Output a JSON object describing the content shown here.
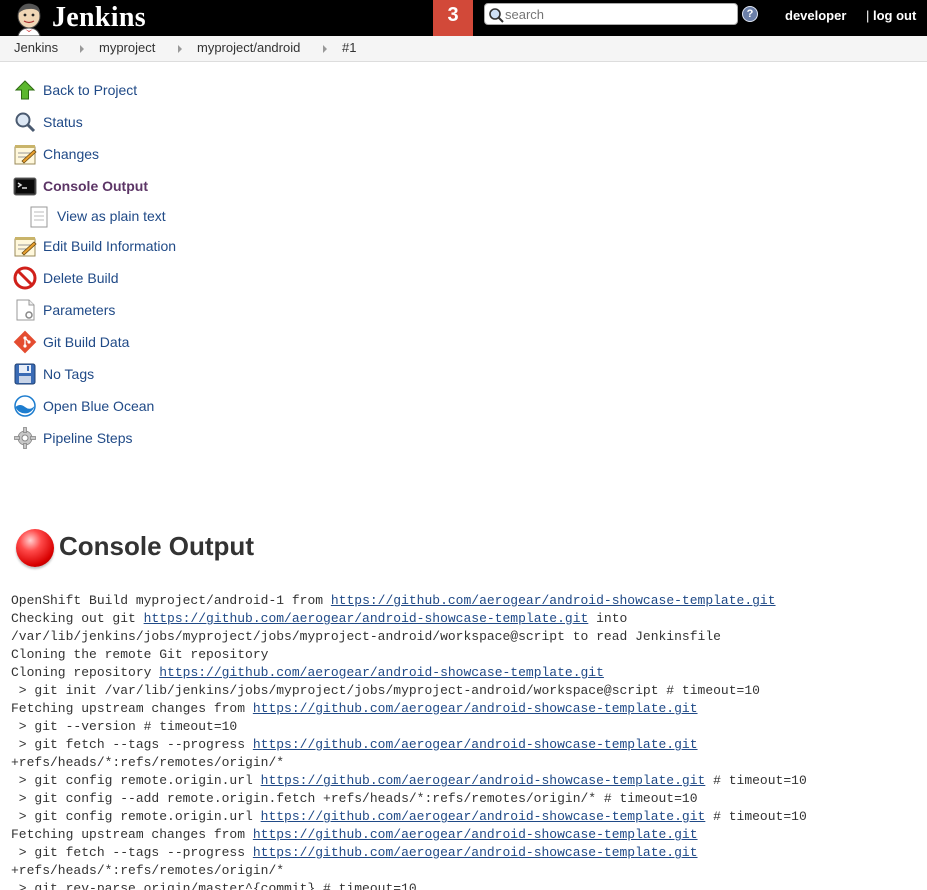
{
  "header": {
    "logo_text": "Jenkins",
    "notification_count": "3",
    "search_placeholder": "search",
    "help_label": "?",
    "user": "developer",
    "logout_sep": "|",
    "logout": "log out"
  },
  "breadcrumb": [
    "Jenkins",
    "myproject",
    "myproject/android",
    "#1"
  ],
  "tasks": [
    {
      "label": "Back to Project",
      "icon": "up-arrow-icon"
    },
    {
      "label": "Status",
      "icon": "magnifier-icon"
    },
    {
      "label": "Changes",
      "icon": "notepad-icon"
    },
    {
      "label": "Console Output",
      "icon": "terminal-icon"
    },
    {
      "label": "View as plain text",
      "icon": "document-icon"
    },
    {
      "label": "Edit Build Information",
      "icon": "notepad-icon"
    },
    {
      "label": "Delete Build",
      "icon": "no-entry-icon"
    },
    {
      "label": "Parameters",
      "icon": "document-icon"
    },
    {
      "label": "Git Build Data",
      "icon": "git-icon"
    },
    {
      "label": "No Tags",
      "icon": "floppy-icon"
    },
    {
      "label": "Open Blue Ocean",
      "icon": "blue-ocean-icon"
    },
    {
      "label": "Pipeline Steps",
      "icon": "gear-icon"
    }
  ],
  "main": {
    "title": "Console Output",
    "status_color": "#e00000"
  },
  "console": [
    {
      "pre": "OpenShift Build myproject/android-1 from ",
      "link": "https://github.com/aerogear/android-showcase-template.git",
      "post": ""
    },
    {
      "pre": "Checking out git ",
      "link": "https://github.com/aerogear/android-showcase-template.git",
      "post": " into"
    },
    {
      "pre": "/var/lib/jenkins/jobs/myproject/jobs/myproject-android/workspace@script to read Jenkinsfile",
      "link": "",
      "post": ""
    },
    {
      "pre": "Cloning the remote Git repository",
      "link": "",
      "post": ""
    },
    {
      "pre": "Cloning repository ",
      "link": "https://github.com/aerogear/android-showcase-template.git",
      "post": ""
    },
    {
      "pre": " > git init /var/lib/jenkins/jobs/myproject/jobs/myproject-android/workspace@script # timeout=10",
      "link": "",
      "post": ""
    },
    {
      "pre": "Fetching upstream changes from ",
      "link": "https://github.com/aerogear/android-showcase-template.git",
      "post": ""
    },
    {
      "pre": " > git --version # timeout=10",
      "link": "",
      "post": ""
    },
    {
      "pre": " > git fetch --tags --progress ",
      "link": "https://github.com/aerogear/android-showcase-template.git",
      "post": ""
    },
    {
      "pre": "+refs/heads/*:refs/remotes/origin/*",
      "link": "",
      "post": ""
    },
    {
      "pre": " > git config remote.origin.url ",
      "link": "https://github.com/aerogear/android-showcase-template.git",
      "post": " # timeout=10"
    },
    {
      "pre": " > git config --add remote.origin.fetch +refs/heads/*:refs/remotes/origin/* # timeout=10",
      "link": "",
      "post": ""
    },
    {
      "pre": " > git config remote.origin.url ",
      "link": "https://github.com/aerogear/android-showcase-template.git",
      "post": " # timeout=10"
    },
    {
      "pre": "Fetching upstream changes from ",
      "link": "https://github.com/aerogear/android-showcase-template.git",
      "post": ""
    },
    {
      "pre": " > git fetch --tags --progress ",
      "link": "https://github.com/aerogear/android-showcase-template.git",
      "post": ""
    },
    {
      "pre": "+refs/heads/*:refs/remotes/origin/*",
      "link": "",
      "post": ""
    },
    {
      "pre": " > git rev-parse origin/master^{commit} # timeout=10",
      "link": "",
      "post": ""
    }
  ]
}
